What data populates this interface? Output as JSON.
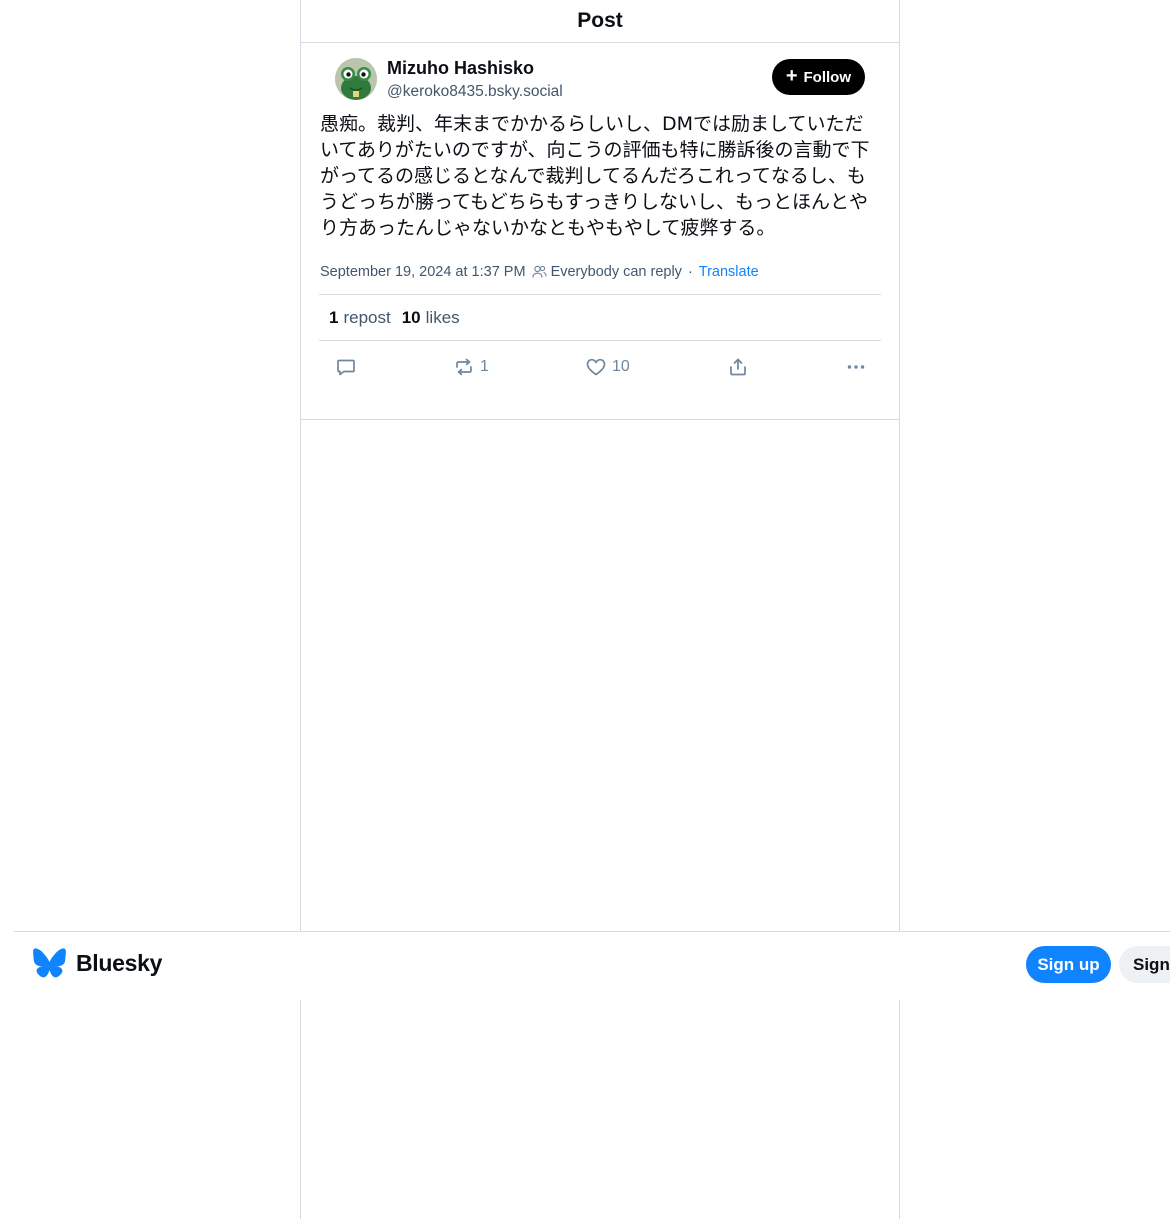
{
  "header": {
    "title": "Post"
  },
  "post": {
    "author": {
      "display_name": "Mizuho Hashisko",
      "handle": "@keroko8435.bsky.social",
      "avatar_icon": "frog-avatar"
    },
    "follow_label": "Follow",
    "text": "愚痴。裁判、年末までかかるらしいし、DMでは励ましていただいてありがたいのですが、向こうの評価も特に勝訴後の言動で下がってるの感じるとなんで裁判してるんだろこれってなるし、もうどっちが勝ってもどちらもすっきりしないし、もっとほんとやり方あったんじゃないかなともやもやして疲弊する。",
    "timestamp": "September 19, 2024 at 1:37 PM",
    "reply_setting": "Everybody can reply",
    "separator": "·",
    "translate_label": "Translate",
    "stats": {
      "reposts_count": "1",
      "reposts_label": "repost",
      "likes_count": "10",
      "likes_label": "likes"
    },
    "actions": {
      "reply_icon": "reply-icon",
      "repost_icon": "repost-icon",
      "repost_count": "1",
      "like_icon": "heart-icon",
      "like_count": "10",
      "share_icon": "share-icon",
      "more_icon": "more-icon"
    }
  },
  "bottom_bar": {
    "logo_text": "Bluesky",
    "signup_label": "Sign up",
    "signin_label": "Sign in"
  },
  "colors": {
    "brand_blue": "#1083fe",
    "border": "#d4dbe2",
    "muted_text": "#42576c"
  }
}
